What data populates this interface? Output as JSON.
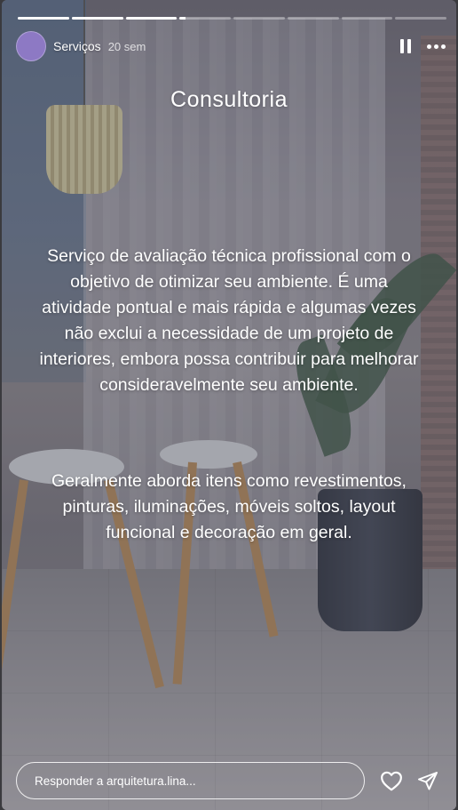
{
  "story": {
    "progress": {
      "segments": 8,
      "completed": 3,
      "current_fraction": 0.12
    },
    "header": {
      "username": "Serviços",
      "time_ago": "20 sem",
      "avatar_color": "#8d79c4",
      "icons": [
        "pause-icon",
        "more-icon"
      ]
    },
    "content": {
      "title": "Consultoria",
      "paragraph1": "Serviço de avaliação técnica profissional com o objetivo de otimizar seu ambiente. É uma atividade pontual e mais rápida e algumas vezes não exclui a necessidade de um projeto de interiores, embora possa contribuir para melhorar consideravelmente seu ambiente.",
      "paragraph2": "Geralmente aborda itens como revestimentos, pinturas, iluminações, móveis soltos, layout funcional e decoração em geral."
    },
    "footer": {
      "reply_placeholder": "Responder a arquitetura.lina...",
      "icons": [
        "heart-icon",
        "send-icon"
      ]
    }
  }
}
